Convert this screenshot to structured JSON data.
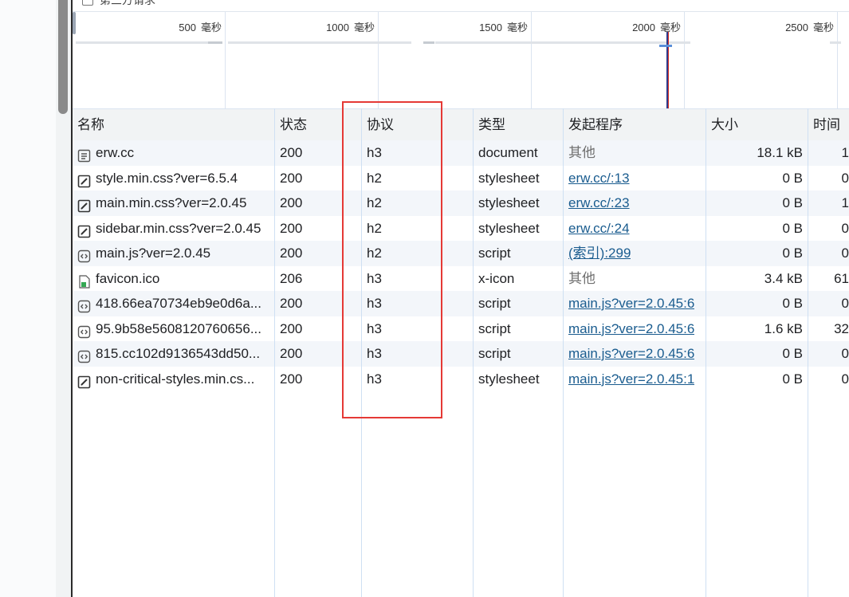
{
  "overview": {
    "third_party_label": "第三方请求",
    "ticks": [
      {
        "value": "500",
        "unit": "毫秒"
      },
      {
        "value": "1000",
        "unit": "毫秒"
      },
      {
        "value": "1500",
        "unit": "毫秒"
      },
      {
        "value": "2000",
        "unit": "毫秒"
      },
      {
        "value": "2500",
        "unit": "毫秒"
      }
    ]
  },
  "columns": {
    "name": "名称",
    "status": "状态",
    "protocol": "协议",
    "type": "类型",
    "initiator": "发起程序",
    "size": "大小",
    "time": "时间"
  },
  "rows": [
    {
      "name": "erw.cc",
      "icon": "document-icon",
      "status": "200",
      "protocol": "h3",
      "type": "document",
      "initiator": "其他",
      "initiator_link": false,
      "size": "18.1 kB",
      "time": "1"
    },
    {
      "name": "style.min.css?ver=6.5.4",
      "icon": "stylesheet-icon",
      "status": "200",
      "protocol": "h2",
      "type": "stylesheet",
      "initiator": "erw.cc/:13",
      "initiator_link": true,
      "size": "0 B",
      "time": "0"
    },
    {
      "name": "main.min.css?ver=2.0.45",
      "icon": "stylesheet-icon",
      "status": "200",
      "protocol": "h2",
      "type": "stylesheet",
      "initiator": "erw.cc/:23",
      "initiator_link": true,
      "size": "0 B",
      "time": "1"
    },
    {
      "name": "sidebar.min.css?ver=2.0.45",
      "icon": "stylesheet-icon",
      "status": "200",
      "protocol": "h2",
      "type": "stylesheet",
      "initiator": "erw.cc/:24",
      "initiator_link": true,
      "size": "0 B",
      "time": "0"
    },
    {
      "name": "main.js?ver=2.0.45",
      "icon": "script-icon",
      "status": "200",
      "protocol": "h2",
      "type": "script",
      "initiator": "(索引):299",
      "initiator_link": true,
      "size": "0 B",
      "time": "0"
    },
    {
      "name": "favicon.ico",
      "icon": "image-icon",
      "status": "206",
      "protocol": "h3",
      "type": "x-icon",
      "initiator": "其他",
      "initiator_link": false,
      "size": "3.4 kB",
      "time": "61"
    },
    {
      "name": "418.66ea70734eb9e0d6a...",
      "icon": "script-icon",
      "status": "200",
      "protocol": "h3",
      "type": "script",
      "initiator": "main.js?ver=2.0.45:6",
      "initiator_link": true,
      "size": "0 B",
      "time": "0"
    },
    {
      "name": "95.9b58e5608120760656...",
      "icon": "script-icon",
      "status": "200",
      "protocol": "h3",
      "type": "script",
      "initiator": "main.js?ver=2.0.45:6",
      "initiator_link": true,
      "size": "1.6 kB",
      "time": "32"
    },
    {
      "name": "815.cc102d9136543dd50...",
      "icon": "script-icon",
      "status": "200",
      "protocol": "h3",
      "type": "script",
      "initiator": "main.js?ver=2.0.45:6",
      "initiator_link": true,
      "size": "0 B",
      "time": "0"
    },
    {
      "name": "non-critical-styles.min.cs...",
      "icon": "stylesheet-icon",
      "status": "200",
      "protocol": "h3",
      "type": "stylesheet",
      "initiator": "main.js?ver=2.0.45:1",
      "initiator_link": true,
      "size": "0 B",
      "time": "0"
    }
  ],
  "colors": {
    "highlight": "#e53935",
    "link": "#1a5c8f",
    "row_alt": "#f3f6fa",
    "grid_line": "#cfe0f3"
  }
}
